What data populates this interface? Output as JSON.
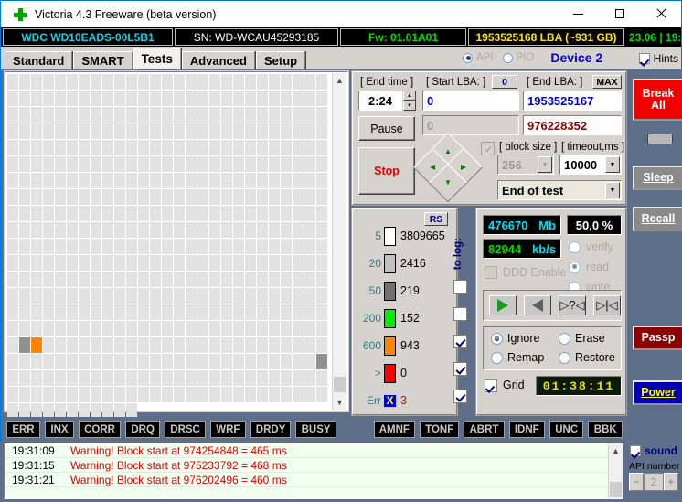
{
  "window": {
    "title": "Victoria 4.3 Freeware (beta version)",
    "icon": "green-cross-icon",
    "minimize": "–",
    "maximize": "□",
    "close": "×"
  },
  "device_bar": {
    "model": "WDC WD10EADS-00L5B1",
    "serial": "SN: WD-WCAU45293185",
    "firmware": "Fw: 01.01A01",
    "capacity": "1953525168 LBA (~931 GB)",
    "clock": "23.06 | 19:31:2"
  },
  "tabs": [
    {
      "label": "Standard",
      "active": false
    },
    {
      "label": "SMART",
      "active": false
    },
    {
      "label": "Tests",
      "active": true
    },
    {
      "label": "Advanced",
      "active": false
    },
    {
      "label": "Setup",
      "active": false
    }
  ],
  "interface": {
    "api_label": "API",
    "pio_label": "PIO",
    "selected": "API",
    "device_label": "Device 2",
    "hints_label": "Hints",
    "hints_checked": true
  },
  "test_params": {
    "end_time_label": "[ End time ]",
    "end_time_value": "2:24",
    "start_lba_label": "[ Start LBA: ]",
    "start_lba_button": "0",
    "start_lba_value": "0",
    "end_lba_label": "[ End LBA: ]",
    "end_lba_button": "MAX",
    "end_lba_value": "1953525167",
    "current_lba_disabled": "0",
    "current_lba_value": "976228352",
    "pause_button": "Pause",
    "stop_button": "Stop",
    "block_size_label": "[ block size ]",
    "block_size_value": "256",
    "timeout_label": "[ timeout,ms ]",
    "timeout_value": "10000",
    "end_action_value": "End of test"
  },
  "grading": {
    "rs_button": "RS",
    "to_log_label": "to log:",
    "rows": [
      {
        "threshold": "5",
        "count": "3809665",
        "color": "#ffffff",
        "log": null
      },
      {
        "threshold": "20",
        "count": "2416",
        "color": "#c0c0c0",
        "log": null
      },
      {
        "threshold": "50",
        "count": "219",
        "color": "#707070",
        "log": false
      },
      {
        "threshold": "200",
        "count": "152",
        "color": "#00ee00",
        "log": false
      },
      {
        "threshold": "600",
        "count": "943",
        "color": "#ff8400",
        "log": true
      },
      {
        "threshold": ">",
        "count": "0",
        "color": "#ff0000",
        "log": true
      },
      {
        "threshold": "Err",
        "count": "3",
        "color": "#0000cd",
        "log": true
      }
    ]
  },
  "results": {
    "processed_value": "476670",
    "processed_unit": "Mb",
    "percent": "50,0 %",
    "speed_value": "82944",
    "speed_unit": "kb/s",
    "ddd_label": "DDD Enable",
    "ddd_checked": false,
    "modes": [
      {
        "label": "verify",
        "selected": false
      },
      {
        "label": "read",
        "selected": true
      },
      {
        "label": "write",
        "selected": false
      }
    ],
    "transport": [
      {
        "name": "scan-forward",
        "glyph": "▶"
      },
      {
        "name": "scan-backward",
        "glyph": "◀"
      },
      {
        "name": "random-read",
        "glyph": "?"
      },
      {
        "name": "butterfly-read",
        "glyph": "▶|◀"
      }
    ],
    "actions": [
      {
        "label": "Ignore",
        "selected": true
      },
      {
        "label": "Erase",
        "selected": false
      },
      {
        "label": "Remap",
        "selected": false
      },
      {
        "label": "Restore",
        "selected": false
      }
    ],
    "grid_label": "Grid",
    "grid_checked": true,
    "timer": "01:38:11"
  },
  "sidebar": {
    "break_all": "Break All",
    "sleep": "Sleep",
    "recall": "Recall",
    "passport": "Passp",
    "power": "Power"
  },
  "status_flags_left": [
    "ERR",
    "INX",
    "CORR",
    "DRQ",
    "DRSC",
    "WRF",
    "DRDY",
    "BUSY"
  ],
  "status_flags_right": [
    "AMNF",
    "TONF",
    "ABRT",
    "IDNF",
    "UNC",
    "BBK"
  ],
  "log": [
    {
      "time": "19:31:09",
      "message": "Warning! Block start at 974254848 = 465 ms"
    },
    {
      "time": "19:31:15",
      "message": "Warning! Block start at 975233792 = 468 ms"
    },
    {
      "time": "19:31:21",
      "message": "Warning! Block start at 976202496 = 460 ms"
    }
  ],
  "footer": {
    "sound_label": "sound",
    "sound_checked": true,
    "api_number_label": "API number",
    "api_number_value": "2",
    "minus": "−",
    "plus": "+"
  },
  "scan_map": {
    "total_cells": 534,
    "cells_per_row": 27,
    "marked": [
      {
        "index": 433,
        "grade": "g50"
      },
      {
        "index": 434,
        "grade": "g600"
      },
      {
        "index": 485,
        "grade": "g50"
      }
    ],
    "partial_last_row": 17
  }
}
